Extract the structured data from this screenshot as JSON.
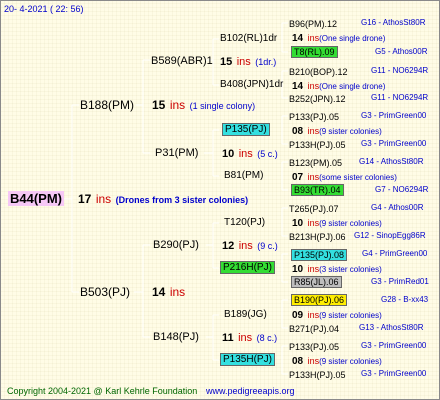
{
  "header": {
    "date": "20-  4-2021 ( 22: 56)"
  },
  "footer": {
    "copyright": "Copyright 2004-2021 @ Karl Kehrle Foundation",
    "url": "www.pedigreeapis.org"
  },
  "root": {
    "name": "B44(PM)",
    "ins_num": "17",
    "ins_label": "ins",
    "note": "(Drones from 3 sister colonies)"
  },
  "gen1": [
    {
      "name": "B188(PM)",
      "ins_num": "15",
      "ins_label": "ins",
      "note": "(1 single colony)"
    },
    {
      "name": "B503(PJ)",
      "ins_num": "14",
      "ins_label": "ins",
      "note": ""
    }
  ],
  "gen2": [
    {
      "name": "B589(ABR)1",
      "ins_num": "15",
      "ins_label": "ins",
      "note": "(1dr.)"
    },
    {
      "name": "P31(PM)",
      "ins_num": "10",
      "ins_label": "ins",
      "note": "(5 c.)"
    },
    {
      "name": "B290(PJ)",
      "ins_num": "12",
      "ins_label": "ins",
      "note": "(9 c.)"
    },
    {
      "name": "B148(PJ)",
      "ins_num": "11",
      "ins_label": "ins",
      "note": "(8 c.)"
    }
  ],
  "gen3": [
    {
      "name": "B102(RL)1dr",
      "ins_num": "14",
      "ins_label": "ins",
      "note": "(One single drone)",
      "highlight": ""
    },
    {
      "name": "B408(JPN)1dr",
      "ins_num": "14",
      "ins_label": "ins",
      "note": "(One single drone)",
      "highlight": ""
    },
    {
      "name": "P135(PJ)",
      "ins_num": "08",
      "ins_label": "ins",
      "note": "(9 sister colonies)",
      "highlight": "cyan"
    },
    {
      "name": "B81(PM)",
      "ins_num": "07",
      "ins_label": "ins",
      "note": "(some sister colonies)",
      "highlight": ""
    },
    {
      "name": "T120(PJ)",
      "ins_num": "10",
      "ins_label": "ins",
      "note": "(9 sister colonies)",
      "highlight": ""
    },
    {
      "name": "P216H(PJ)",
      "ins_num": "10",
      "ins_label": "ins",
      "note": "(3 sister colonies)",
      "highlight": "green"
    },
    {
      "name": "B189(JG)",
      "ins_num": "09",
      "ins_label": "ins",
      "note": "(9 sister colonies)",
      "highlight": ""
    },
    {
      "name": "P135H(PJ)",
      "ins_num": "08",
      "ins_label": "ins",
      "note": "(9 sister colonies)",
      "highlight": "cyan"
    }
  ],
  "gen4": [
    {
      "name": "B96(PM).12",
      "meta": "G16 - AthosSt80R",
      "highlight": ""
    },
    {
      "name": "T8(RL).09",
      "meta": "G5 - Athos00R",
      "highlight": "green"
    },
    {
      "name": "B210(BOP).12",
      "meta": "G11 - NO6294R",
      "highlight": ""
    },
    {
      "name": "B252(JPN).12",
      "meta": "G11 - NO6294R",
      "highlight": ""
    },
    {
      "name": "P133(PJ).05",
      "meta": "G3 - PrimGreen00",
      "highlight": ""
    },
    {
      "name": "P133H(PJ).05",
      "meta": "G3 - PrimGreen00",
      "highlight": ""
    },
    {
      "name": "B123(PM).05",
      "meta": "G14 - AthosSt80R",
      "highlight": ""
    },
    {
      "name": "B93(TR).04",
      "meta": "G7 - NO6294R",
      "highlight": "green"
    },
    {
      "name": "T265(PJ).07",
      "meta": "G4 - Athos00R",
      "highlight": ""
    },
    {
      "name": "B213H(PJ).06",
      "meta": "G12 - SinopEgg86R",
      "highlight": ""
    },
    {
      "name": "P135(PJ).08",
      "meta": "G4 - PrimGreen00",
      "highlight": "cyan"
    },
    {
      "name": "R85(JL).06",
      "meta": "G3 - PrimRed01",
      "highlight": "gray"
    },
    {
      "name": "B190(PJ).06",
      "meta": "G28 - B-xx43",
      "highlight": "yellow"
    },
    {
      "name": "B271(PJ).04",
      "meta": "G13 - AthosSt80R",
      "highlight": ""
    },
    {
      "name": "P133(PJ).05",
      "meta": "G3 - PrimGreen00",
      "highlight": ""
    },
    {
      "name": "P133H(PJ).05",
      "meta": "G3 - PrimGreen00",
      "highlight": ""
    }
  ]
}
